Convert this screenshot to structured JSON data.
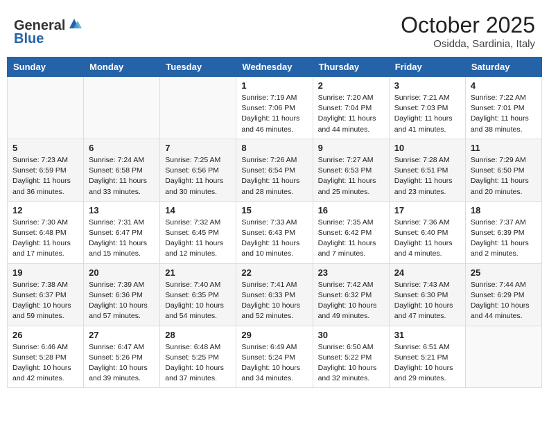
{
  "header": {
    "logo_line1": "General",
    "logo_line2": "Blue",
    "month": "October 2025",
    "location": "Osidda, Sardinia, Italy"
  },
  "days_of_week": [
    "Sunday",
    "Monday",
    "Tuesday",
    "Wednesday",
    "Thursday",
    "Friday",
    "Saturday"
  ],
  "weeks": [
    [
      {
        "day": "",
        "info": ""
      },
      {
        "day": "",
        "info": ""
      },
      {
        "day": "",
        "info": ""
      },
      {
        "day": "1",
        "info": "Sunrise: 7:19 AM\nSunset: 7:06 PM\nDaylight: 11 hours and 46 minutes."
      },
      {
        "day": "2",
        "info": "Sunrise: 7:20 AM\nSunset: 7:04 PM\nDaylight: 11 hours and 44 minutes."
      },
      {
        "day": "3",
        "info": "Sunrise: 7:21 AM\nSunset: 7:03 PM\nDaylight: 11 hours and 41 minutes."
      },
      {
        "day": "4",
        "info": "Sunrise: 7:22 AM\nSunset: 7:01 PM\nDaylight: 11 hours and 38 minutes."
      }
    ],
    [
      {
        "day": "5",
        "info": "Sunrise: 7:23 AM\nSunset: 6:59 PM\nDaylight: 11 hours and 36 minutes."
      },
      {
        "day": "6",
        "info": "Sunrise: 7:24 AM\nSunset: 6:58 PM\nDaylight: 11 hours and 33 minutes."
      },
      {
        "day": "7",
        "info": "Sunrise: 7:25 AM\nSunset: 6:56 PM\nDaylight: 11 hours and 30 minutes."
      },
      {
        "day": "8",
        "info": "Sunrise: 7:26 AM\nSunset: 6:54 PM\nDaylight: 11 hours and 28 minutes."
      },
      {
        "day": "9",
        "info": "Sunrise: 7:27 AM\nSunset: 6:53 PM\nDaylight: 11 hours and 25 minutes."
      },
      {
        "day": "10",
        "info": "Sunrise: 7:28 AM\nSunset: 6:51 PM\nDaylight: 11 hours and 23 minutes."
      },
      {
        "day": "11",
        "info": "Sunrise: 7:29 AM\nSunset: 6:50 PM\nDaylight: 11 hours and 20 minutes."
      }
    ],
    [
      {
        "day": "12",
        "info": "Sunrise: 7:30 AM\nSunset: 6:48 PM\nDaylight: 11 hours and 17 minutes."
      },
      {
        "day": "13",
        "info": "Sunrise: 7:31 AM\nSunset: 6:47 PM\nDaylight: 11 hours and 15 minutes."
      },
      {
        "day": "14",
        "info": "Sunrise: 7:32 AM\nSunset: 6:45 PM\nDaylight: 11 hours and 12 minutes."
      },
      {
        "day": "15",
        "info": "Sunrise: 7:33 AM\nSunset: 6:43 PM\nDaylight: 11 hours and 10 minutes."
      },
      {
        "day": "16",
        "info": "Sunrise: 7:35 AM\nSunset: 6:42 PM\nDaylight: 11 hours and 7 minutes."
      },
      {
        "day": "17",
        "info": "Sunrise: 7:36 AM\nSunset: 6:40 PM\nDaylight: 11 hours and 4 minutes."
      },
      {
        "day": "18",
        "info": "Sunrise: 7:37 AM\nSunset: 6:39 PM\nDaylight: 11 hours and 2 minutes."
      }
    ],
    [
      {
        "day": "19",
        "info": "Sunrise: 7:38 AM\nSunset: 6:37 PM\nDaylight: 10 hours and 59 minutes."
      },
      {
        "day": "20",
        "info": "Sunrise: 7:39 AM\nSunset: 6:36 PM\nDaylight: 10 hours and 57 minutes."
      },
      {
        "day": "21",
        "info": "Sunrise: 7:40 AM\nSunset: 6:35 PM\nDaylight: 10 hours and 54 minutes."
      },
      {
        "day": "22",
        "info": "Sunrise: 7:41 AM\nSunset: 6:33 PM\nDaylight: 10 hours and 52 minutes."
      },
      {
        "day": "23",
        "info": "Sunrise: 7:42 AM\nSunset: 6:32 PM\nDaylight: 10 hours and 49 minutes."
      },
      {
        "day": "24",
        "info": "Sunrise: 7:43 AM\nSunset: 6:30 PM\nDaylight: 10 hours and 47 minutes."
      },
      {
        "day": "25",
        "info": "Sunrise: 7:44 AM\nSunset: 6:29 PM\nDaylight: 10 hours and 44 minutes."
      }
    ],
    [
      {
        "day": "26",
        "info": "Sunrise: 6:46 AM\nSunset: 5:28 PM\nDaylight: 10 hours and 42 minutes."
      },
      {
        "day": "27",
        "info": "Sunrise: 6:47 AM\nSunset: 5:26 PM\nDaylight: 10 hours and 39 minutes."
      },
      {
        "day": "28",
        "info": "Sunrise: 6:48 AM\nSunset: 5:25 PM\nDaylight: 10 hours and 37 minutes."
      },
      {
        "day": "29",
        "info": "Sunrise: 6:49 AM\nSunset: 5:24 PM\nDaylight: 10 hours and 34 minutes."
      },
      {
        "day": "30",
        "info": "Sunrise: 6:50 AM\nSunset: 5:22 PM\nDaylight: 10 hours and 32 minutes."
      },
      {
        "day": "31",
        "info": "Sunrise: 6:51 AM\nSunset: 5:21 PM\nDaylight: 10 hours and 29 minutes."
      },
      {
        "day": "",
        "info": ""
      }
    ]
  ]
}
